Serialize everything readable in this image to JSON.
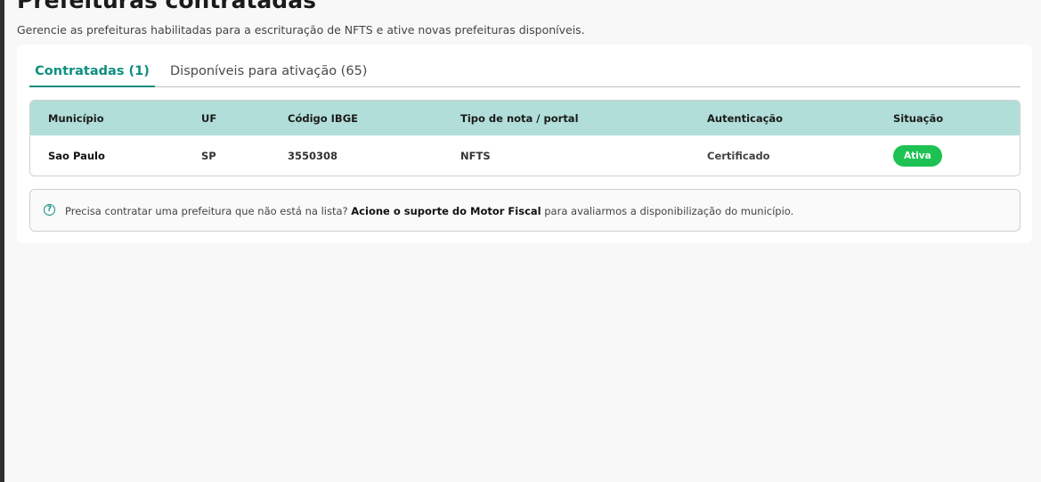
{
  "page": {
    "title": "Prefeituras contratadas",
    "subtitle": "Gerencie as prefeituras habilitadas para a escrituração de NFTS e ative novas prefeituras disponíveis."
  },
  "tabs": [
    {
      "label": "Contratadas (1)",
      "active": true
    },
    {
      "label": "Disponíveis para ativação (65)",
      "active": false
    }
  ],
  "table": {
    "headers": [
      "Município",
      "UF",
      "Código IBGE",
      "Tipo de nota / portal",
      "Autenticação",
      "Situação"
    ],
    "rows": [
      {
        "municipio": "Sao Paulo",
        "uf": "SP",
        "codigo_ibge": "3550308",
        "tipo": "NFTS",
        "autenticacao": "Certificado",
        "situacao": "Ativa"
      }
    ]
  },
  "notice": {
    "icon": "help-circle-icon",
    "text_before": "Precisa contratar uma prefeitura que não está na lista? ",
    "link_text": "Acione o suporte do Motor Fiscal",
    "text_after": " para avaliarmos a disponibilização do município."
  },
  "colors": {
    "accent": "#0f8f80",
    "table_header_bg": "#b2ded9",
    "status_active": "#1dc253",
    "page_bg": "#f8f8f8"
  }
}
